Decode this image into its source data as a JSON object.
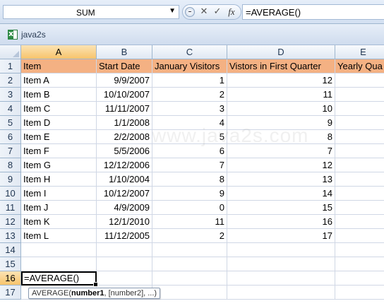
{
  "formula_bar": {
    "name_box": "SUM",
    "name_box_arrow": "▼",
    "cancel_icon": "✕",
    "enter_icon": "✓",
    "fx_icon": "fx",
    "formula": "=AVERAGE()"
  },
  "workbook": {
    "title": "java2s",
    "watermark": "www.java2s.com"
  },
  "columns": [
    "A",
    "B",
    "C",
    "D",
    "E"
  ],
  "rows": [
    "1",
    "2",
    "3",
    "4",
    "5",
    "6",
    "7",
    "8",
    "9",
    "10",
    "11",
    "12",
    "13",
    "14",
    "15",
    "16",
    "17"
  ],
  "table": {
    "header": [
      "Item",
      "Start Date",
      "January Visitors",
      "Vistors in First Quarter",
      "Yearly Qua"
    ],
    "data": [
      [
        "Item A",
        "9/9/2007",
        "1",
        "12"
      ],
      [
        "Item B",
        "10/10/2007",
        "2",
        "11"
      ],
      [
        "Item C",
        "11/11/2007",
        "3",
        "10"
      ],
      [
        "Item D",
        "1/1/2008",
        "4",
        "9"
      ],
      [
        "Item E",
        "2/2/2008",
        "5",
        "8"
      ],
      [
        "Item F",
        "5/5/2006",
        "6",
        "7"
      ],
      [
        "Item G",
        "12/12/2006",
        "7",
        "12"
      ],
      [
        "Item H",
        "1/10/2004",
        "8",
        "13"
      ],
      [
        "Item I",
        "10/12/2007",
        "9",
        "14"
      ],
      [
        "Item J",
        "4/9/2009",
        "0",
        "15"
      ],
      [
        "Item K",
        "12/1/2010",
        "11",
        "16"
      ],
      [
        "Item L",
        "11/12/2005",
        "2",
        "17"
      ]
    ]
  },
  "active_cell": {
    "ref": "A16",
    "content": "=AVERAGE()"
  },
  "tooltip": {
    "fn": "AVERAGE(",
    "arg1": "number1",
    "rest": ", [number2], ...)"
  },
  "colors": {
    "header_fill": "#f4b183",
    "selected_header": "#f7c46c",
    "grid_line": "#d0d7e5"
  }
}
